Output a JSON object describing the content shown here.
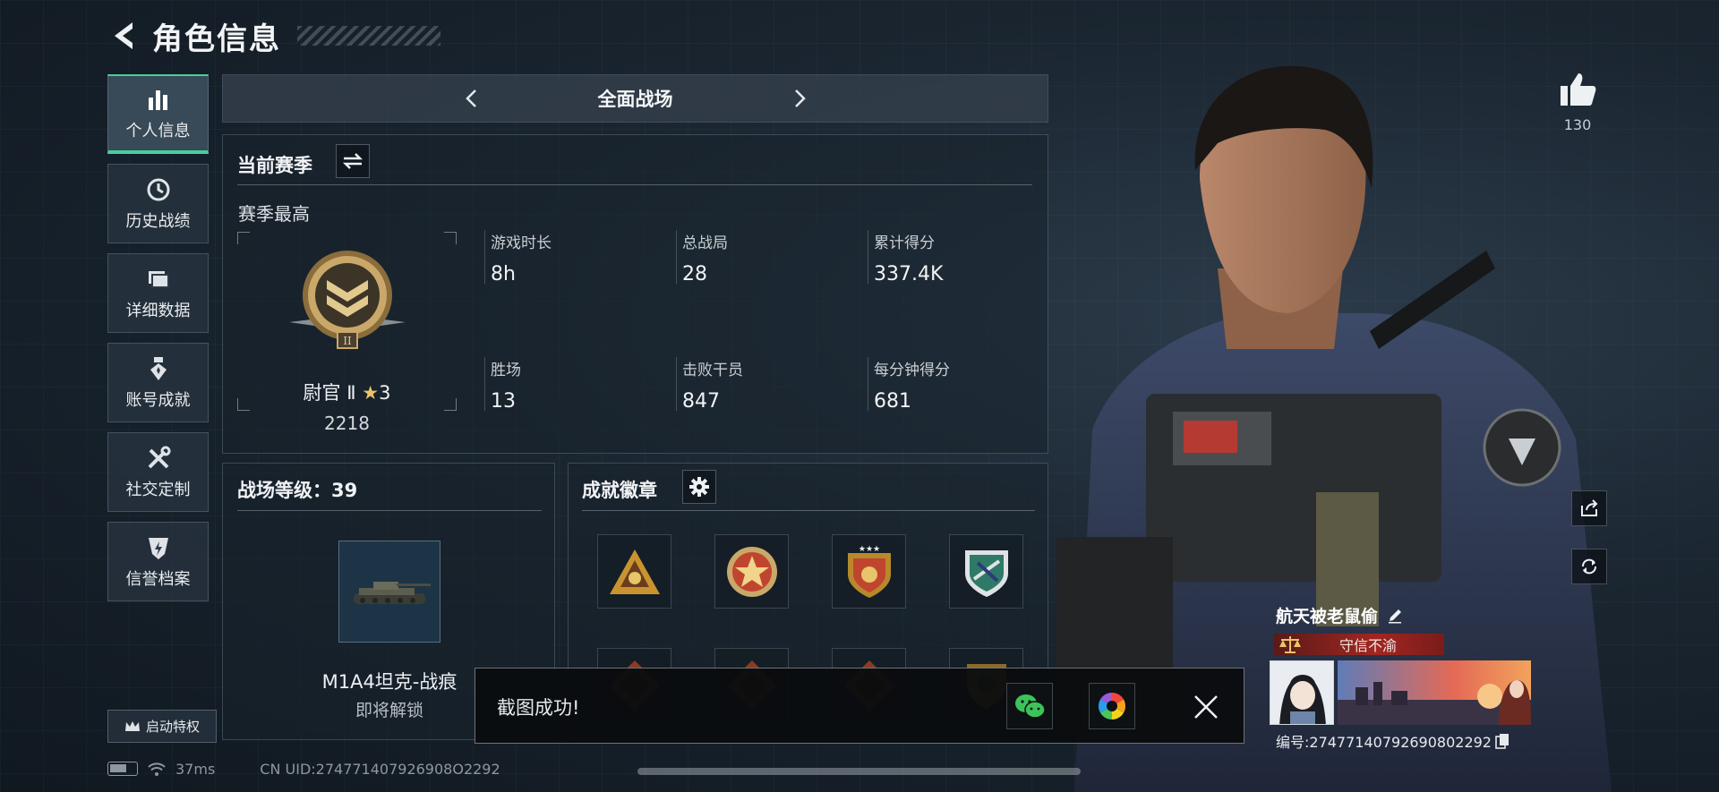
{
  "header": {
    "title": "角色信息"
  },
  "nav": {
    "items": [
      {
        "label": "个人信息"
      },
      {
        "label": "历史战绩"
      },
      {
        "label": "详细数据"
      },
      {
        "label": "账号成就"
      },
      {
        "label": "社交定制"
      },
      {
        "label": "信誉档案"
      }
    ],
    "special_button": "启动特权"
  },
  "mode_selector": {
    "label": "全面战场"
  },
  "season": {
    "title": "当前赛季",
    "best_label": "赛季最高",
    "rank_name": "尉官 Ⅱ",
    "rank_stars": "3",
    "rank_points": "2218",
    "stats": [
      {
        "label": "游戏时长",
        "value": "8h"
      },
      {
        "label": "总战局",
        "value": "28"
      },
      {
        "label": "累计得分",
        "value": "337.4K"
      },
      {
        "label": "胜场",
        "value": "13"
      },
      {
        "label": "击败干员",
        "value": "847"
      },
      {
        "label": "每分钟得分",
        "value": "681"
      }
    ]
  },
  "battle_level": {
    "title": "战场等级：39",
    "vehicle_name": "M1A4坦克-战痕",
    "vehicle_status": "即将解锁"
  },
  "achievements": {
    "title": "成就徽章",
    "badges": [
      {
        "icon": "triangle-gold-badge-icon",
        "color": "#c9932f"
      },
      {
        "icon": "star-medal-badge-icon",
        "color": "#c0452f"
      },
      {
        "icon": "shield-stars-badge-icon",
        "color": "#b8892b"
      },
      {
        "icon": "green-shield-badge-icon",
        "color": "#2f7a66"
      },
      {
        "icon": "diamond-brown-badge-icon",
        "color": "#8a3b26"
      },
      {
        "icon": "diamond-brown-badge-icon",
        "color": "#8a3b26"
      },
      {
        "icon": "diamond-brown-badge-icon",
        "color": "#8a3b26"
      },
      {
        "icon": "shield-gold-badge-icon",
        "color": "#8d6a2b"
      }
    ]
  },
  "toast": {
    "message": "截图成功!"
  },
  "status_bar": {
    "latency": "37ms",
    "uid": "CN UID:274771407926908O2292"
  },
  "profile": {
    "likes": "130",
    "player_name": "航天被老鼠偷",
    "credit_title": "守信不渝",
    "player_id": "编号:27477140792690802292"
  },
  "colors": {
    "accent": "#46d09e",
    "credit": "#a12622",
    "wechat": "#3cc35a"
  }
}
